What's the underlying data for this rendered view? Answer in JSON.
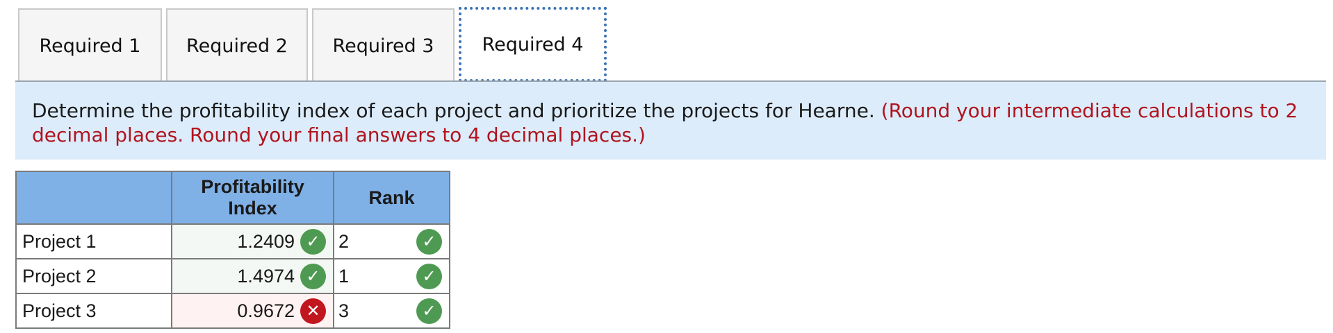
{
  "tabs": [
    {
      "label": "Required 1",
      "active": false
    },
    {
      "label": "Required 2",
      "active": false
    },
    {
      "label": "Required 3",
      "active": false
    },
    {
      "label": "Required 4",
      "active": true
    }
  ],
  "instruction": {
    "text": "Determine the profitability index of each project and prioritize the projects for Hearne.",
    "note": "(Round your intermediate calculations to 2 decimal places. Round your final answers to 4 decimal places.)"
  },
  "table": {
    "headers": {
      "label": "",
      "pi_line1": "Profitability",
      "pi_line2": "Index",
      "rank": "Rank"
    },
    "rows": [
      {
        "label": "Project 1",
        "pi": "1.2409",
        "pi_status": "correct",
        "rank": "2",
        "rank_status": "correct"
      },
      {
        "label": "Project 2",
        "pi": "1.4974",
        "pi_status": "correct",
        "rank": "1",
        "rank_status": "correct"
      },
      {
        "label": "Project 3",
        "pi": "0.9672",
        "pi_status": "incorrect",
        "rank": "3",
        "rank_status": "correct"
      }
    ],
    "status_icons": {
      "correct": "check-mark-icon",
      "incorrect": "x-mark-icon"
    },
    "colors": {
      "header_bg": "#7fb0e6",
      "correct": "#4f9a52",
      "incorrect": "#c2161f",
      "note": "#b0141f",
      "instruction_bg": "#dcecfa"
    }
  }
}
